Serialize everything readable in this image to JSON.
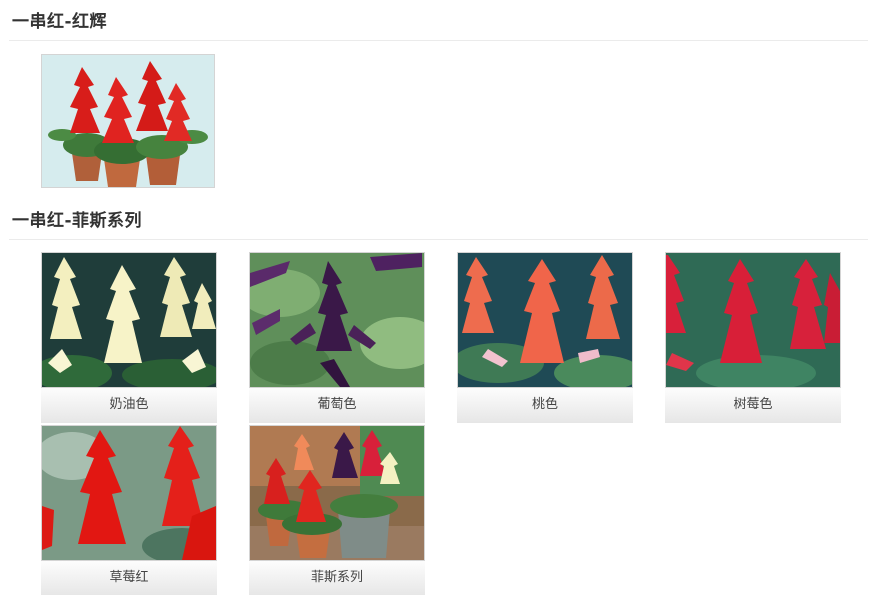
{
  "sections": [
    {
      "title": "一串红-红辉"
    },
    {
      "title": "一串红-菲斯系列"
    }
  ],
  "feis_series": {
    "items": [
      {
        "label": "奶油色",
        "flower_color": "#f4f1c2"
      },
      {
        "label": "葡萄色",
        "flower_color": "#3a1848"
      },
      {
        "label": "桃色",
        "flower_color": "#f0654a"
      },
      {
        "label": "树莓色",
        "flower_color": "#d8203a"
      },
      {
        "label": "草莓红",
        "flower_color": "#e21712"
      },
      {
        "label": "菲斯系列",
        "flower_color": "#d8201e"
      }
    ]
  },
  "colors": {
    "title_text": "#333333",
    "divider": "#ebebeb",
    "caption_bg_top": "#fdfdfd",
    "caption_bg_bottom": "#e6e6e6"
  }
}
